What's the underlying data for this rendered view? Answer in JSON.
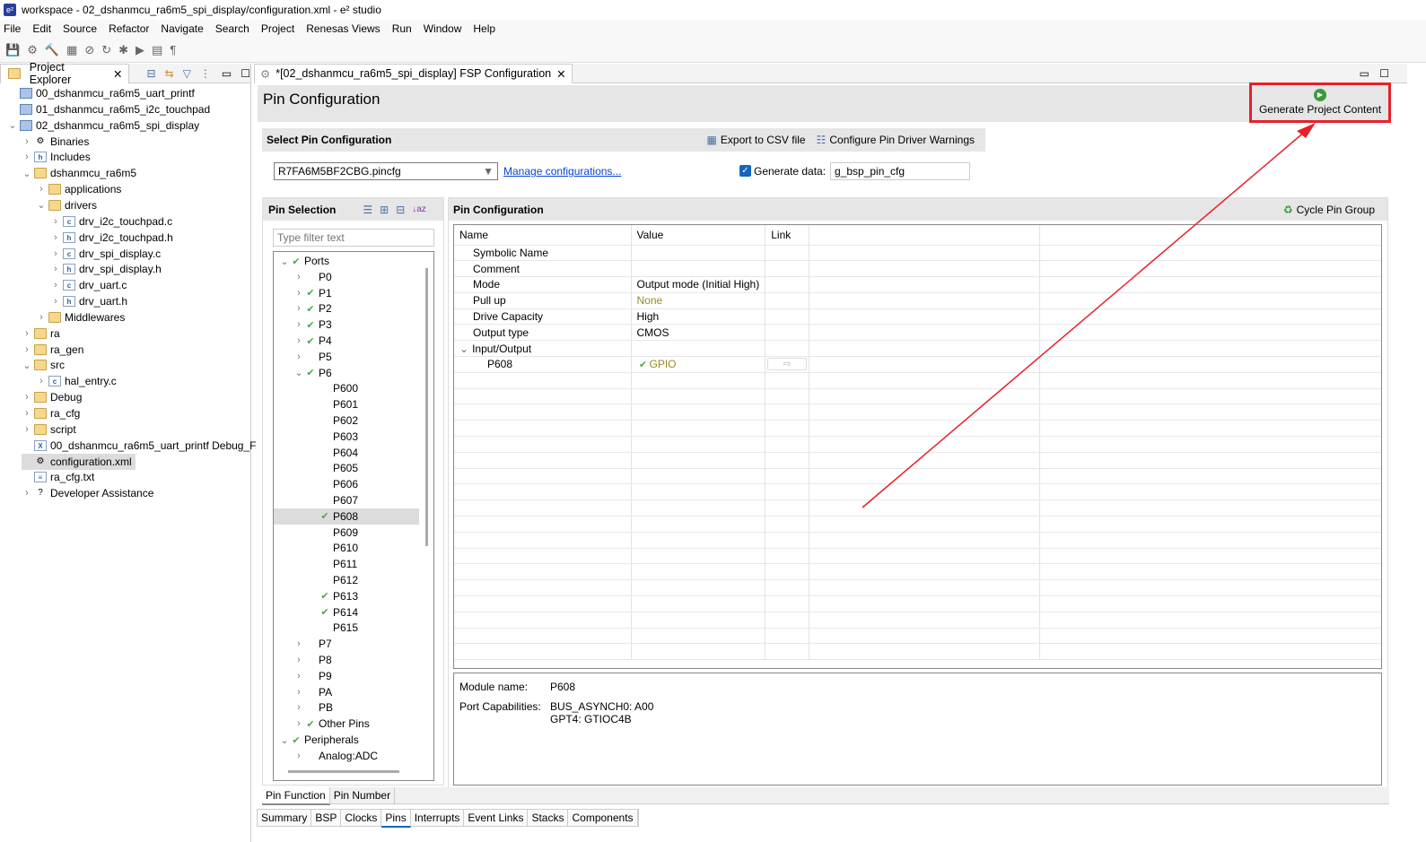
{
  "window": {
    "title": "workspace - 02_dshanmcu_ra6m5_spi_display/configuration.xml - e² studio",
    "logo": "e2"
  },
  "menu": [
    "File",
    "Edit",
    "Source",
    "Refactor",
    "Navigate",
    "Search",
    "Project",
    "Renesas Views",
    "Run",
    "Window",
    "Help"
  ],
  "toolbar_icons": [
    "save-icon",
    "settings-icon",
    "hammer-icon",
    "grid-icon",
    "link-icon",
    "refresh-icon",
    "debug-icon",
    "run-icon",
    "doc-icon",
    "pilcrow-icon"
  ],
  "project_explorer": {
    "tab": "Project Explorer",
    "items": [
      {
        "label": "00_dshanmcu_ra6m5_uart_printf",
        "depth": 0,
        "chev": "",
        "icon": "proj"
      },
      {
        "label": "01_dshanmcu_ra6m5_i2c_touchpad",
        "depth": 0,
        "chev": "",
        "icon": "proj"
      },
      {
        "label": "02_dshanmcu_ra6m5_spi_display",
        "depth": 0,
        "chev": "v",
        "icon": "proj"
      },
      {
        "label": "Binaries",
        "depth": 1,
        "chev": ">",
        "icon": "bin"
      },
      {
        "label": "Includes",
        "depth": 1,
        "chev": ">",
        "icon": "inc"
      },
      {
        "label": "dshanmcu_ra6m5",
        "depth": 1,
        "chev": "v",
        "icon": "folder"
      },
      {
        "label": "applications",
        "depth": 2,
        "chev": ">",
        "icon": "folder"
      },
      {
        "label": "drivers",
        "depth": 2,
        "chev": "v",
        "icon": "folder"
      },
      {
        "label": "drv_i2c_touchpad.c",
        "depth": 3,
        "chev": ">",
        "icon": "c"
      },
      {
        "label": "drv_i2c_touchpad.h",
        "depth": 3,
        "chev": ">",
        "icon": "h"
      },
      {
        "label": "drv_spi_display.c",
        "depth": 3,
        "chev": ">",
        "icon": "c"
      },
      {
        "label": "drv_spi_display.h",
        "depth": 3,
        "chev": ">",
        "icon": "h"
      },
      {
        "label": "drv_uart.c",
        "depth": 3,
        "chev": ">",
        "icon": "c"
      },
      {
        "label": "drv_uart.h",
        "depth": 3,
        "chev": ">",
        "icon": "h"
      },
      {
        "label": "Middlewares",
        "depth": 2,
        "chev": ">",
        "icon": "folder"
      },
      {
        "label": "ra",
        "depth": 1,
        "chev": ">",
        "icon": "folder"
      },
      {
        "label": "ra_gen",
        "depth": 1,
        "chev": ">",
        "icon": "folder"
      },
      {
        "label": "src",
        "depth": 1,
        "chev": "v",
        "icon": "folder"
      },
      {
        "label": "hal_entry.c",
        "depth": 2,
        "chev": ">",
        "icon": "c"
      },
      {
        "label": "Debug",
        "depth": 1,
        "chev": ">",
        "icon": "folder"
      },
      {
        "label": "ra_cfg",
        "depth": 1,
        "chev": ">",
        "icon": "folder"
      },
      {
        "label": "script",
        "depth": 1,
        "chev": ">",
        "icon": "folder"
      },
      {
        "label": "00_dshanmcu_ra6m5_uart_printf Debug_F",
        "depth": 1,
        "chev": "",
        "icon": "x"
      },
      {
        "label": "configuration.xml",
        "depth": 1,
        "chev": "",
        "icon": "gear",
        "selected": true
      },
      {
        "label": "ra_cfg.txt",
        "depth": 1,
        "chev": "",
        "icon": "txt"
      },
      {
        "label": "Developer Assistance",
        "depth": 1,
        "chev": ">",
        "icon": "help"
      }
    ]
  },
  "editor": {
    "tab": "*[02_dshanmcu_ra6m5_spi_display] FSP Configuration",
    "page_title": "Pin Configuration",
    "generate_button": "Generate Project Content",
    "select_section": "Select Pin Configuration",
    "export_csv": "Export to CSV file",
    "configure_warnings": "Configure Pin Driver Warnings",
    "config_combo": "R7FA6M5BF2CBG.pincfg",
    "manage_link": "Manage configurations...",
    "generate_data_label": "Generate data:",
    "generate_data_checked": true,
    "generate_data_value": "g_bsp_pin_cfg",
    "pin_selection": {
      "title": "Pin Selection",
      "filter_placeholder": "Type filter text",
      "items": [
        {
          "label": "Ports",
          "depth": 0,
          "chev": "v",
          "check": true
        },
        {
          "label": "P0",
          "depth": 1,
          "chev": ">",
          "check": false
        },
        {
          "label": "P1",
          "depth": 1,
          "chev": ">",
          "check": true
        },
        {
          "label": "P2",
          "depth": 1,
          "chev": ">",
          "check": true
        },
        {
          "label": "P3",
          "depth": 1,
          "chev": ">",
          "check": true
        },
        {
          "label": "P4",
          "depth": 1,
          "chev": ">",
          "check": true
        },
        {
          "label": "P5",
          "depth": 1,
          "chev": ">",
          "check": false
        },
        {
          "label": "P6",
          "depth": 1,
          "chev": "v",
          "check": true
        },
        {
          "label": "P600",
          "depth": 2,
          "check": false
        },
        {
          "label": "P601",
          "depth": 2,
          "check": false
        },
        {
          "label": "P602",
          "depth": 2,
          "check": false
        },
        {
          "label": "P603",
          "depth": 2,
          "check": false
        },
        {
          "label": "P604",
          "depth": 2,
          "check": false
        },
        {
          "label": "P605",
          "depth": 2,
          "check": false
        },
        {
          "label": "P606",
          "depth": 2,
          "check": false
        },
        {
          "label": "P607",
          "depth": 2,
          "check": false
        },
        {
          "label": "P608",
          "depth": 2,
          "check": true,
          "selected": true
        },
        {
          "label": "P609",
          "depth": 2,
          "check": false
        },
        {
          "label": "P610",
          "depth": 2,
          "check": false
        },
        {
          "label": "P611",
          "depth": 2,
          "check": false
        },
        {
          "label": "P612",
          "depth": 2,
          "check": false
        },
        {
          "label": "P613",
          "depth": 2,
          "check": true
        },
        {
          "label": "P614",
          "depth": 2,
          "check": true
        },
        {
          "label": "P615",
          "depth": 2,
          "check": false
        },
        {
          "label": "P7",
          "depth": 1,
          "chev": ">",
          "check": false
        },
        {
          "label": "P8",
          "depth": 1,
          "chev": ">",
          "check": false
        },
        {
          "label": "P9",
          "depth": 1,
          "chev": ">",
          "check": false
        },
        {
          "label": "PA",
          "depth": 1,
          "chev": ">",
          "check": false
        },
        {
          "label": "PB",
          "depth": 1,
          "chev": ">",
          "check": false
        },
        {
          "label": "Other Pins",
          "depth": 1,
          "chev": ">",
          "check": true
        },
        {
          "label": "Peripherals",
          "depth": 0,
          "chev": "v",
          "check": true
        },
        {
          "label": "Analog:ADC",
          "depth": 1,
          "chev": ">",
          "check": false
        }
      ]
    },
    "pin_config": {
      "title": "Pin Configuration",
      "cycle": "Cycle Pin Group",
      "columns": [
        "Name",
        "Value",
        "Link"
      ],
      "rows": [
        {
          "name": "Symbolic Name",
          "value": ""
        },
        {
          "name": "Comment",
          "value": ""
        },
        {
          "name": "Mode",
          "value": "Output mode (Initial High)"
        },
        {
          "name": "Pull up",
          "value": "None",
          "muted": true
        },
        {
          "name": "Drive Capacity",
          "value": "High"
        },
        {
          "name": "Output type",
          "value": "CMOS"
        },
        {
          "name": "Input/Output",
          "value": "",
          "group": true
        },
        {
          "name": "P608",
          "value": "GPIO",
          "sub": true,
          "check": true,
          "link": true
        }
      ],
      "module_name_label": "Module name:",
      "module_name": "P608",
      "capabilities_label": "Port Capabilities:",
      "capabilities": [
        "BUS_ASYNCH0: A00",
        "GPT4: GTIOC4B"
      ]
    },
    "view_tabs": [
      "Pin Function",
      "Pin Number"
    ],
    "bottom_tabs": [
      "Summary",
      "BSP",
      "Clocks",
      "Pins",
      "Interrupts",
      "Event Links",
      "Stacks",
      "Components"
    ],
    "active_bottom_tab": "Pins"
  },
  "colors": {
    "highlight": "#e8202a",
    "check": "#4caa4c",
    "muted": "#9a8a20",
    "link": "#0645d8"
  }
}
